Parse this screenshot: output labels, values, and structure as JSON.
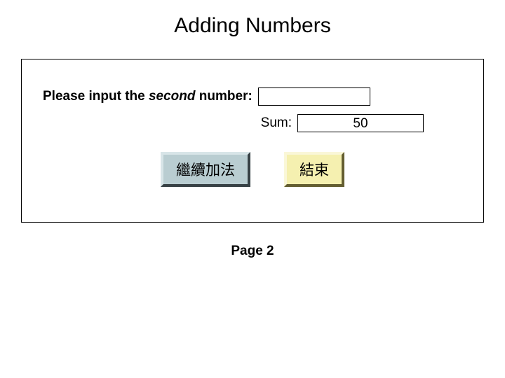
{
  "title": "Adding Numbers",
  "prompt": {
    "prefix": "Please input the ",
    "emph": "second",
    "suffix": " number:"
  },
  "input_value": "",
  "sum_label": "Sum:",
  "sum_value": "50",
  "buttons": {
    "continue_label": "繼續加法",
    "end_label": "結束"
  },
  "page_label": "Page 2"
}
